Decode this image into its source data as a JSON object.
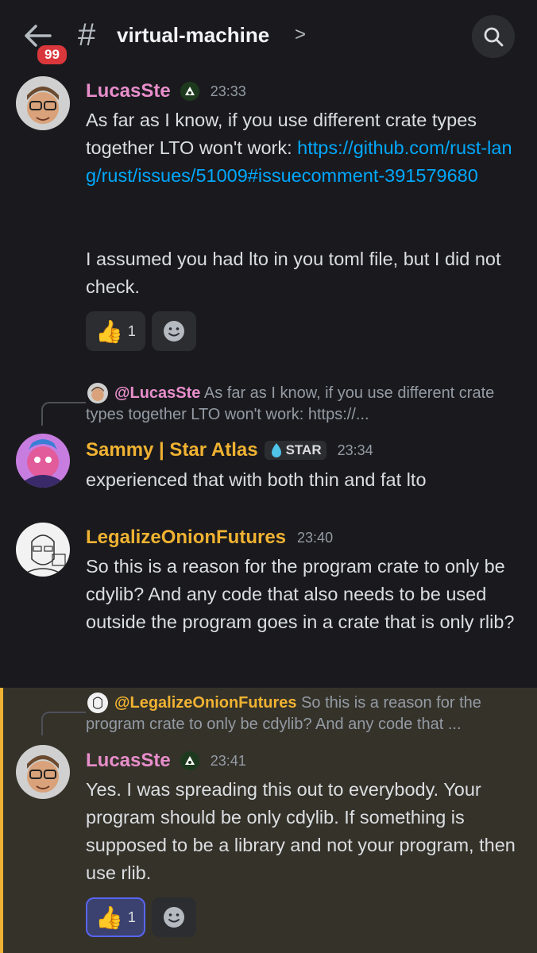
{
  "header": {
    "unread_count": "99",
    "channel_name": "virtual-machine",
    "chevron": ">"
  },
  "messages": [
    {
      "author": "LucasSte",
      "time": "23:33",
      "text_before_link": "As far as I know, if you use different crate types together LTO won't work: ",
      "link": "https://github.com/rust-lang/rust/issues/51009#issuecomment-391579680",
      "text_after": "I assumed you had lto in you toml file, but I did not check.",
      "reaction": {
        "emoji": "👍",
        "count": "1"
      }
    },
    {
      "reply_to": "@LucasSte",
      "reply_preview": "As far as I know, if you use different crate types together LTO won't work: https://...",
      "author": "Sammy | Star Atlas",
      "role": "STAR",
      "time": "23:34",
      "text": "experienced that with both thin and fat lto"
    },
    {
      "author": "LegalizeOnionFutures",
      "time": "23:40",
      "text": "So this is a reason for the program crate to only be cdylib? And any code that also needs to be used outside the program goes in a crate that is only rlib?"
    },
    {
      "reply_to": "@LegalizeOnionFutures",
      "reply_preview": "So this is a reason for the program crate to only be cdylib? And any code that ...",
      "author": "LucasSte",
      "time": "23:41",
      "text": "Yes. I was spreading this out to everybody. Your program should be only cdylib. If something is supposed to be a library and not your program, then use rlib.",
      "reaction": {
        "emoji": "👍",
        "count": "1"
      }
    }
  ],
  "colors": {
    "background": "#1a1a1e",
    "link": "#00a8fc",
    "mention_highlight": "#35322a",
    "mention_bar": "#f0b232",
    "lucas_name": "#e88ecb",
    "yellow_name": "#f0b232"
  }
}
